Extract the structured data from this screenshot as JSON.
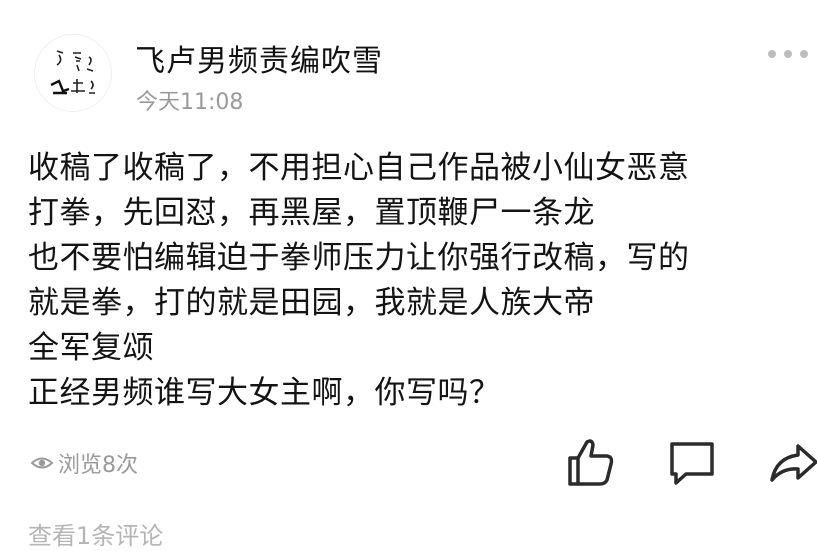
{
  "post": {
    "author": {
      "name": "飞卢男频责编吹雪",
      "avatar_icon": "calligraphy-avatar-icon"
    },
    "time": "今天11:08",
    "more_icon": "more-dots-icon",
    "content_lines": [
      "收稿了收稿了，不用担心自己作品被小仙女恶意",
      "打拳，先回怼，再黑屋，置顶鞭尸一条龙",
      "也不要怕编辑迫于拳师压力让你强行改稿，写的",
      "就是拳，打的就是田园，我就是人族大帝",
      "全军复颂",
      "正经男频谁写大女主啊，你写吗？"
    ],
    "views": {
      "label": "浏览8次",
      "icon": "eye-icon"
    },
    "actions": {
      "like_icon": "thumbs-up-icon",
      "comment_icon": "comment-icon",
      "share_icon": "share-arrow-icon"
    },
    "view_comments_label": "查看1条评论"
  },
  "colors": {
    "text_primary": "#141414",
    "text_secondary": "#9a9a9a",
    "icon": "#2b2b2b",
    "background": "#ffffff"
  }
}
